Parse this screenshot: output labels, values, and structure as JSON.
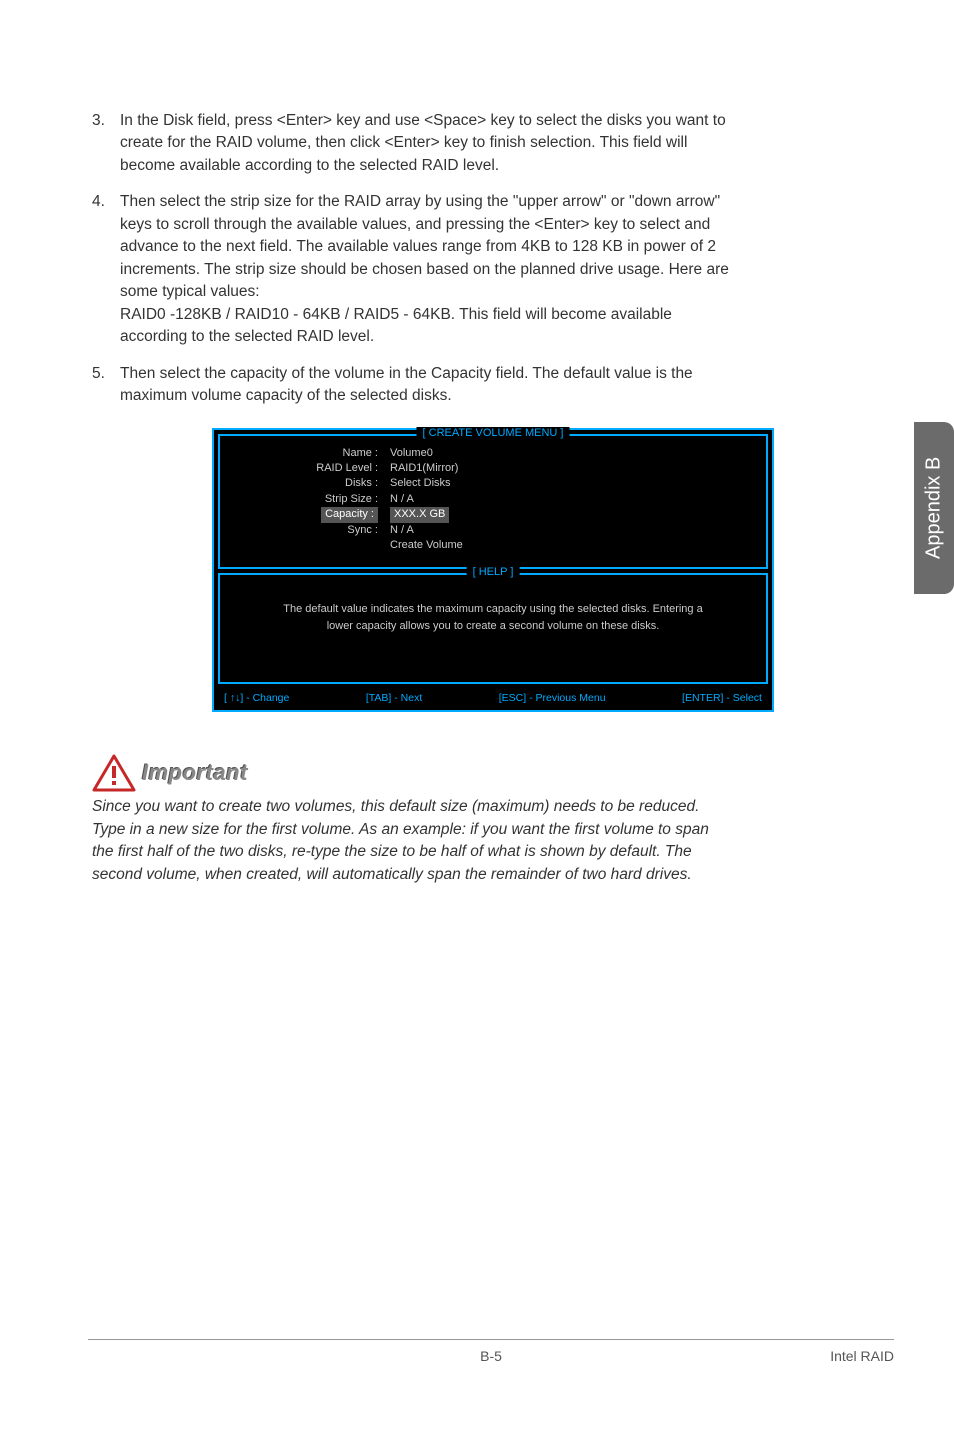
{
  "list": [
    {
      "num": "3.",
      "text": "In the Disk field, press <Enter> key and use <Space> key to select the disks you want to create for the RAID volume, then click <Enter> key to finish selection. This field will become available according to the selected RAID level."
    },
    {
      "num": "4.",
      "text": "Then select the strip size for the RAID array by using the \"upper arrow\" or \"down arrow\" keys to scroll through the available values, and pressing the <Enter> key to select and advance to the next field. The available values range from 4KB to 128 KB in power of 2 increments. The strip size should be chosen based on the planned drive usage. Here are some typical values:\nRAID0 -128KB / RAID10 - 64KB / RAID5 - 64KB. This field will become available according to the selected RAID level."
    },
    {
      "num": "5.",
      "text": "Then select the capacity of the volume in the Capacity field. The default value is the maximum volume capacity of the selected disks."
    }
  ],
  "sidebar": "Appendix B",
  "bios": {
    "title_top": "[  CREATE VOLUME MENU  ]",
    "title_help": "[   HELP   ]",
    "fields": {
      "name_label": "Name :",
      "name_value": "Volume0",
      "raid_label": "RAID Level :",
      "raid_value": "RAID1(Mirror)",
      "disks_label": "Disks :",
      "disks_value": "Select  Disks",
      "strip_label": "Strip Size :",
      "strip_value": "N / A",
      "capacity_label": "Capacity :",
      "capacity_value": "XXX.X  GB",
      "sync_label": "Sync :",
      "sync_value": "N / A",
      "create_value": "Create Volume"
    },
    "help_text": "The default value indicates the maximum capacity using the selected disks. Entering a lower capacity allows you to create a second volume  on  these  disks.",
    "footer": {
      "change": "[ ↑↓] - Change",
      "tab": "[TAB] - Next",
      "esc": "[ESC] - Previous Menu",
      "enter": "[ENTER] - Select"
    }
  },
  "important": {
    "label": "Important",
    "text": "Since you want to create two volumes, this default size (maximum) needs to be reduced. Type in a new size for the first volume. As an example: if you want the first volume to span the first half of the two disks, re-type the size to be half of what is shown by default. The second volume, when created, will automatically span the remainder of two hard drives."
  },
  "footer": {
    "page": "B-5",
    "section": "Intel RAID"
  }
}
